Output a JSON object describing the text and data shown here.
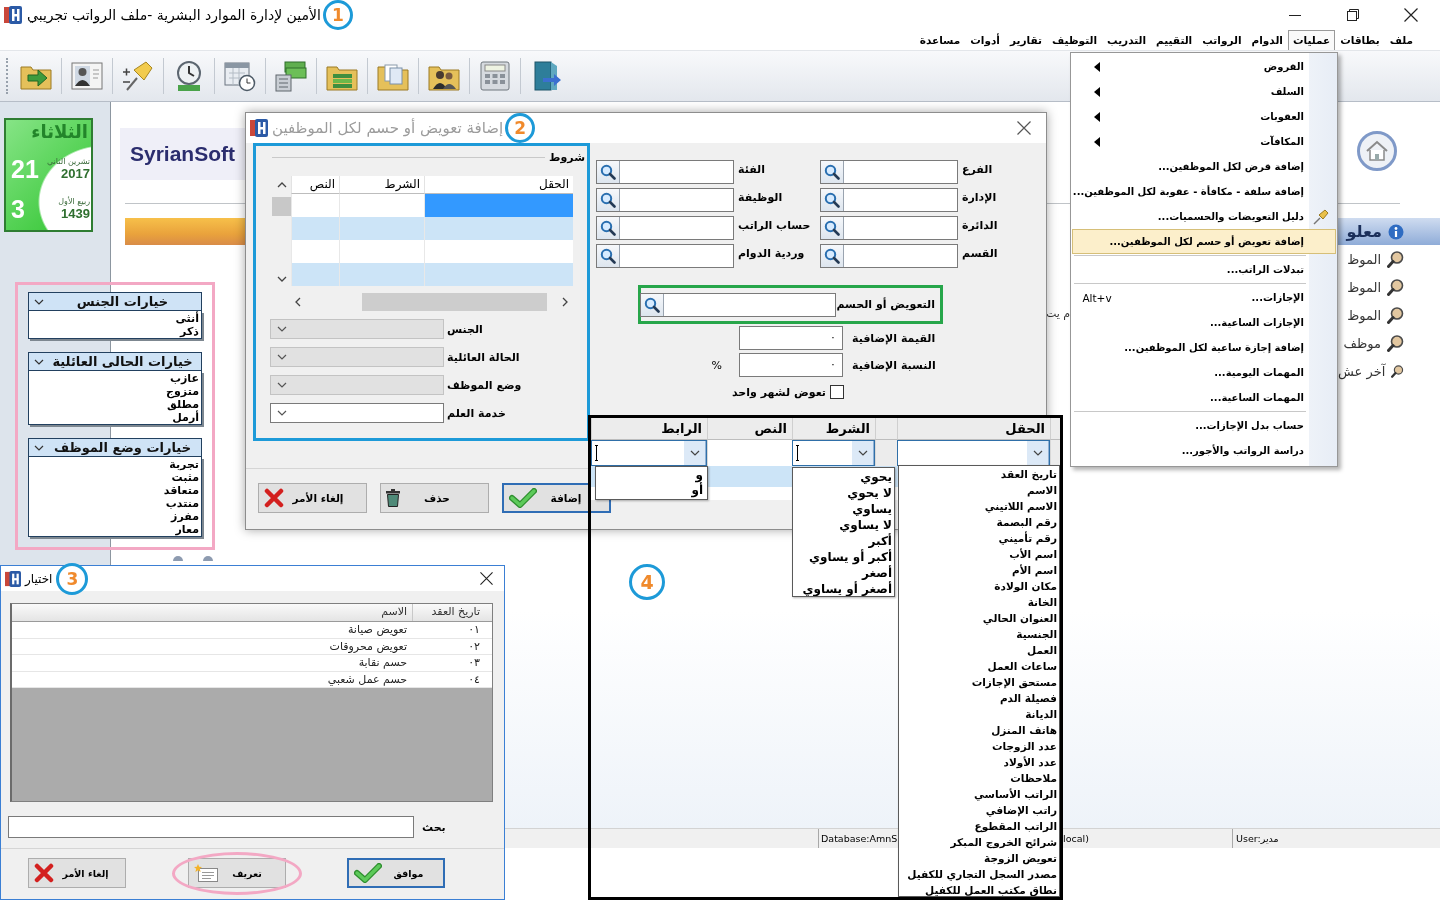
{
  "main_window": {
    "title": "الأمين لإدارة الموارد البشرية -ملف الرواتب تجريبي",
    "callout": "1",
    "menu_bar": [
      {
        "label": "ملف",
        "selected": false
      },
      {
        "label": "بطاقات",
        "selected": false
      },
      {
        "label": "عمليات",
        "selected": true
      },
      {
        "label": "الدوام",
        "selected": false
      },
      {
        "label": "الرواتب",
        "selected": false
      },
      {
        "label": "التقييم",
        "selected": false
      },
      {
        "label": "التدريب",
        "selected": false
      },
      {
        "label": "التوظيف",
        "selected": false
      },
      {
        "label": "تقارير",
        "selected": false
      },
      {
        "label": "أدوات",
        "selected": false
      },
      {
        "label": "مساعدة",
        "selected": false
      }
    ],
    "calendar": {
      "weekday": "الثلاثاء",
      "day": "21",
      "month": "تشرين الثاني",
      "year": "2017",
      "hijri_day": "3",
      "hijri_month": "ربيع الأول",
      "hijri_year": "1439"
    },
    "logo": "SyrianSoft",
    "partial_text": "م يت",
    "info_panel": {
      "title": "معلو",
      "items": [
        "الموظ",
        "الموظ",
        "الموظ",
        "موظف",
        "آخر عش"
      ]
    },
    "status_bar": [
      "User:مدير",
      "local)",
      "Database:AmnS"
    ]
  },
  "operations_menu": [
    {
      "label": "القروض",
      "kind": "submenu",
      "selected": false
    },
    {
      "label": "السلف",
      "kind": "submenu",
      "selected": false
    },
    {
      "label": "العقوبات",
      "kind": "submenu",
      "selected": false
    },
    {
      "label": "المكافآت",
      "kind": "submenu",
      "selected": false
    },
    {
      "label": "إضافة قرض لكل الموظفين...",
      "kind": "item",
      "selected": false
    },
    {
      "label": "إضافة سلفة - مكافأة - عقوبة لكل الموظفين...",
      "kind": "item",
      "selected": false
    },
    {
      "label": "دليل التعويضات والحسميات...",
      "kind": "icon_item",
      "selected": false
    },
    {
      "label": "إضافة تعويض أو حسم لكل الموظفين...",
      "kind": "item",
      "selected": true
    },
    {
      "kind": "separator"
    },
    {
      "label": "تبدلات الراتب...",
      "kind": "item",
      "selected": false
    },
    {
      "kind": "separator"
    },
    {
      "label": "الإجازات...",
      "kind": "item",
      "selected": false,
      "shortcut": "Alt+v"
    },
    {
      "label": "الإجازات الساعية...",
      "kind": "item",
      "selected": false
    },
    {
      "label": "إضافة إجازة ساعية لكل الموظفين...",
      "kind": "item",
      "selected": false
    },
    {
      "label": "المهمات اليومية...",
      "kind": "item",
      "selected": false
    },
    {
      "label": "المهمات الساعية...",
      "kind": "item",
      "selected": false
    },
    {
      "kind": "separator"
    },
    {
      "label": "حساب بدل الإجازات...",
      "kind": "item",
      "selected": false
    },
    {
      "label": "دراسة الرواتب والأجور...",
      "kind": "item",
      "selected": false
    }
  ],
  "option_panels": [
    {
      "title": "خيارات الجنس",
      "items": [
        "أنثى",
        "ذكر"
      ]
    },
    {
      "title": "خيارات الحالى العائلية",
      "items": [
        "عازب",
        "متزوج",
        "مطلق",
        "أرمل"
      ]
    },
    {
      "title": "خيارات وضع الموظف",
      "items": [
        "تجربة",
        "مثبت",
        "متعاقد",
        "منتدب",
        "مفرز",
        "معار"
      ]
    }
  ],
  "add_dialog": {
    "title": "إضافة تعويض أو حسم لكل الموظفين",
    "active": false,
    "callout": "2",
    "conditions": {
      "title": "شروط",
      "columns": [
        "الحقل",
        "الشرط",
        "النص"
      ],
      "rows": [
        {
          "selected": true
        },
        {
          "selected": false
        },
        {
          "selected": false
        },
        {
          "selected": false
        }
      ],
      "filters": [
        {
          "label": "الجنس",
          "disabled": true
        },
        {
          "label": "الحالة العائلية",
          "disabled": true
        },
        {
          "label": "وضع الموظف",
          "disabled": true
        },
        {
          "label": "خدمة العلم",
          "disabled": false
        }
      ]
    },
    "lookups": [
      {
        "label": "الفرع"
      },
      {
        "label": "الفئة"
      },
      {
        "label": "الإدارة"
      },
      {
        "label": "الوظيفة"
      },
      {
        "label": "الدائرة"
      },
      {
        "label": "حساب الراتب"
      },
      {
        "label": "القسم"
      },
      {
        "label": "وردية الدوام"
      }
    ],
    "allowance": {
      "label": "التعويض أو الحسم"
    },
    "extra_value": {
      "label": "القيمة الإضافية",
      "value": "٠"
    },
    "extra_percent": {
      "label": "النسبة الإضافية",
      "value": "٠",
      "unit": "%"
    },
    "one_month": {
      "label": "تعوض لشهر واحد",
      "checked": false
    },
    "buttons": [
      {
        "label": "إضافة",
        "kind": "add",
        "focused": true
      },
      {
        "label": "حذف",
        "kind": "delete",
        "focused": false
      },
      {
        "label": "إلغاء الأمر",
        "kind": "cancel",
        "focused": false
      }
    ]
  },
  "dropdown_view": {
    "callout": "4",
    "columns": [
      "الحقل",
      "الشرط",
      "النص",
      "الرابط"
    ],
    "field_options": [
      "تاريخ العقد",
      "الاسم",
      "الاسم اللاتيني",
      "رقم البصمة",
      "رقم تأميني",
      "اسم الأب",
      "اسم الأم",
      "مكان الولادة",
      "الخانة",
      "العنوان الحالي",
      "الجنسية",
      "العمل",
      "ساعات العمل",
      "مستحق الإجازات",
      "فصيلة الدم",
      "الديانة",
      "هاتف المنزل",
      "عدد الزوجات",
      "عدد الأولاد",
      "ملاحظات",
      "الراتب الأساسي",
      "راتب الإضافي",
      "الراتب المقطوع",
      "شرائح الخروج المبكر",
      "تعويض الزوجة",
      "مصدر السجل التجاري للكفيل",
      "نطاق مكتب العمل للكفيل"
    ],
    "condition_options": [
      "يحوي",
      "لا يحوي",
      "يساوي",
      "لا يساوي",
      "أكبر",
      "أكبر أو يساوي",
      "أصغر",
      "أصغر أو يساوي"
    ],
    "link_options": [
      "و",
      "أو"
    ]
  },
  "select_dialog": {
    "title": "اختيار",
    "active": true,
    "callout": "3",
    "columns": [
      "تاريخ العقد",
      "الاسم"
    ],
    "rows": [
      {
        "number": "٠١",
        "name": "تعويض صيانة"
      },
      {
        "number": "٠٢",
        "name": "تعويض محروقات"
      },
      {
        "number": "٠٣",
        "name": "حسم نقابة"
      },
      {
        "number": "٠٤",
        "name": "حسم عمل شعبي"
      }
    ],
    "search": {
      "label": "بحث"
    },
    "buttons": [
      {
        "label": "موافق",
        "kind": "ok",
        "focused": true,
        "circled": false
      },
      {
        "label": "تعريف",
        "kind": "define",
        "focused": false,
        "circled": true
      },
      {
        "label": "إلغاء الأمر",
        "kind": "cancel",
        "focused": false,
        "circled": false
      }
    ]
  }
}
